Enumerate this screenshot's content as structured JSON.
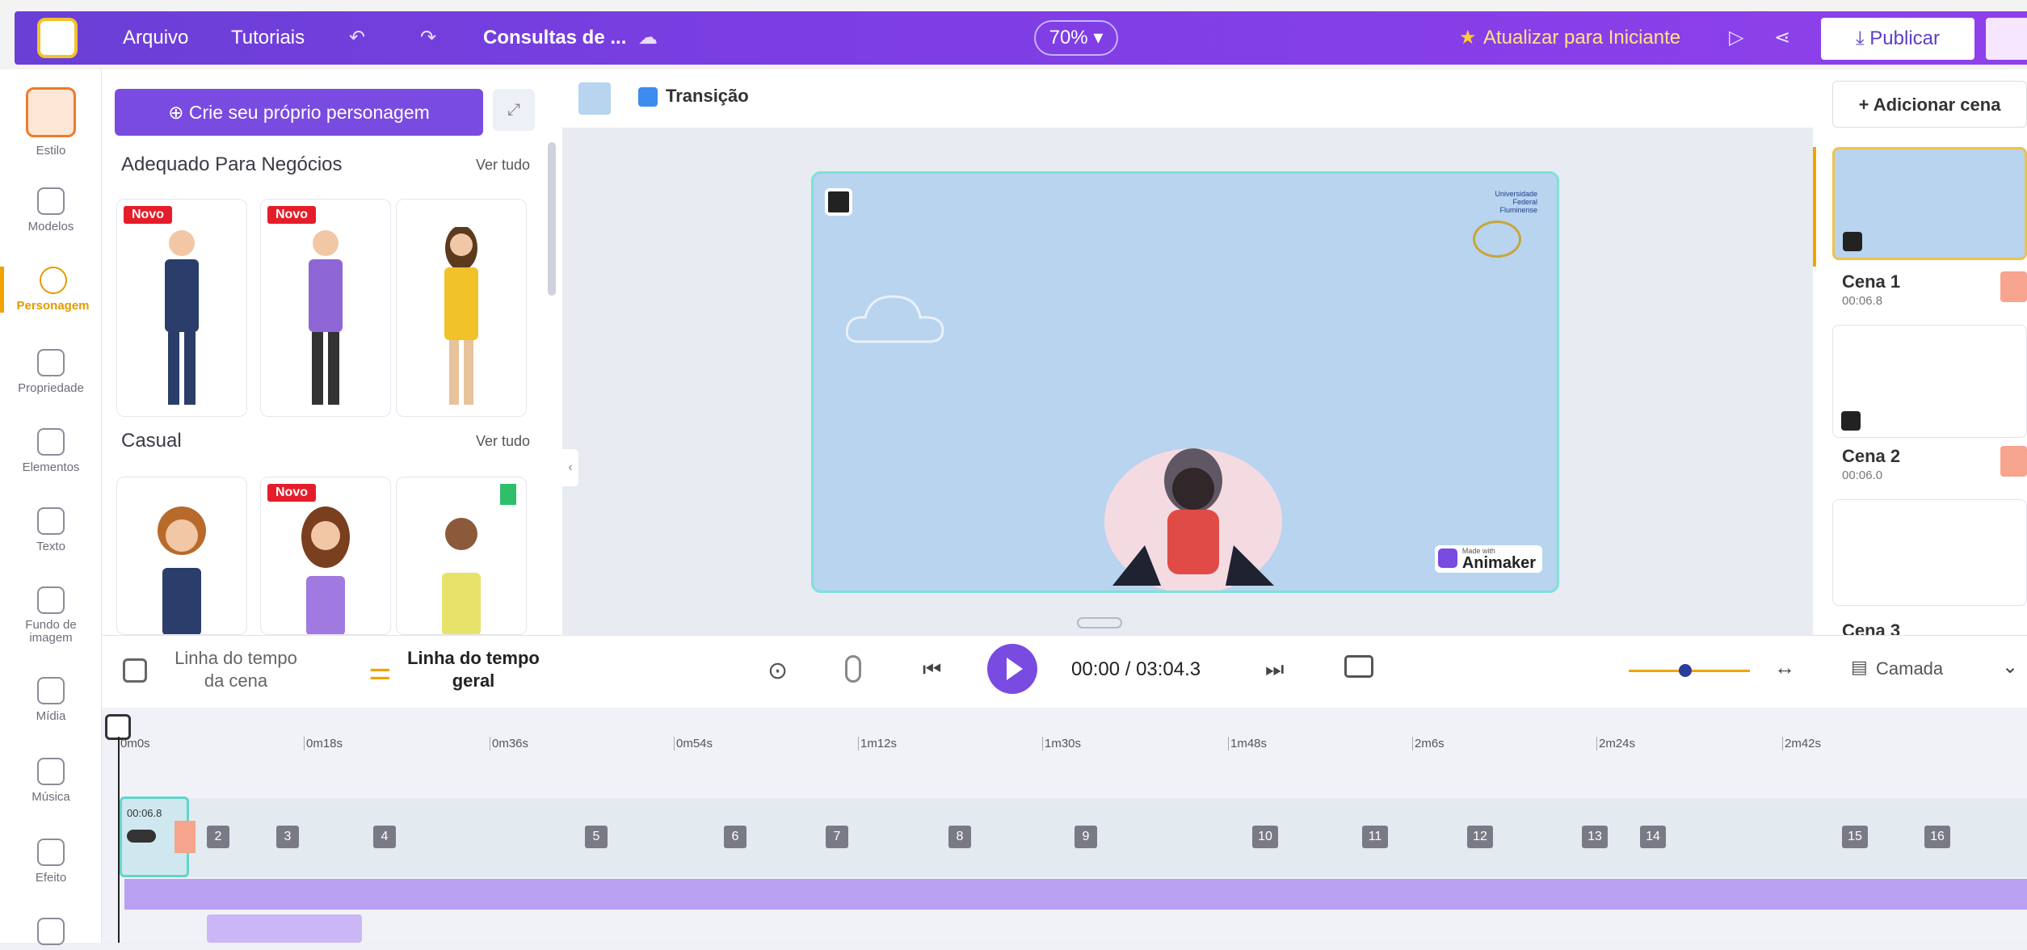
{
  "topbar": {
    "menu_file": "Arquivo",
    "menu_tutorials": "Tutoriais",
    "project_title": "Consultas de ...",
    "zoom": "70%",
    "upgrade": "Atualizar para Iniciante",
    "publish": "Publicar"
  },
  "rail": {
    "items": [
      {
        "label": "Estilo"
      },
      {
        "label": "Modelos"
      },
      {
        "label": "Personagem"
      },
      {
        "label": "Propriedade"
      },
      {
        "label": "Elementos"
      },
      {
        "label": "Texto"
      },
      {
        "label": "Fundo de imagem"
      },
      {
        "label": "Mídia"
      },
      {
        "label": "Música"
      },
      {
        "label": "Efeito"
      }
    ]
  },
  "panel": {
    "create_button": "Crie seu próprio personagem",
    "section1_title": "Adequado Para Negócios",
    "section2_title": "Casual",
    "see_all": "Ver tudo",
    "badge_new": "Novo"
  },
  "canvas": {
    "transition": "Transição",
    "uff_text1": "Universidade",
    "uff_text2": "Federal",
    "uff_text3": "Fluminense",
    "made_with": "Made with",
    "animaker": "Animaker"
  },
  "scenes": {
    "add_button": "+ Adicionar cena",
    "list": [
      {
        "name": "Cena 1",
        "time": "00:06.8"
      },
      {
        "name": "Cena 2",
        "time": "00:06.0"
      },
      {
        "name": "Cena 3",
        "time": ""
      }
    ]
  },
  "timeline": {
    "scene_timeline": "Linha do tempo da cena",
    "general_timeline": "Linha do tempo geral",
    "time_display": "00:00 / 03:04.3",
    "layer": "Camada",
    "ruler": [
      "0m0s",
      "0m18s",
      "0m36s",
      "0m54s",
      "1m12s",
      "1m30s",
      "1m48s",
      "2m6s",
      "2m24s",
      "2m42s"
    ],
    "first_segment_time": "00:06.8",
    "segments": [
      "2",
      "3",
      "4",
      "5",
      "6",
      "7",
      "8",
      "9",
      "10",
      "11",
      "12",
      "13",
      "14",
      "15",
      "16"
    ]
  }
}
